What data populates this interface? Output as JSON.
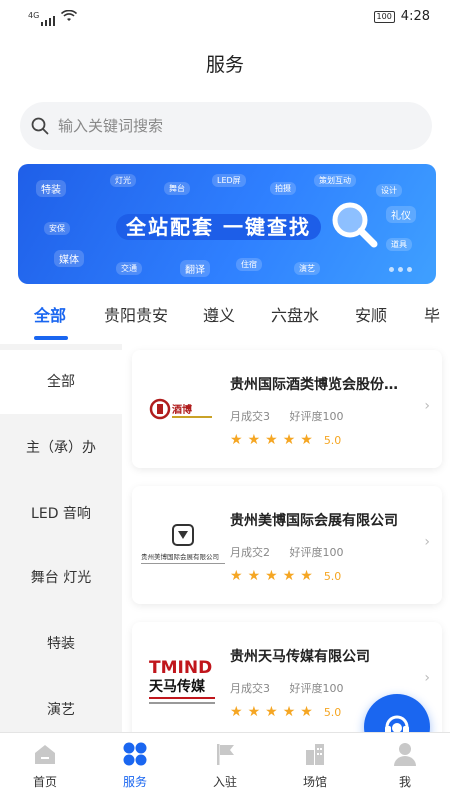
{
  "status": {
    "network": "4G",
    "battery": "100",
    "time": "4:28"
  },
  "header": {
    "title": "服务"
  },
  "search": {
    "placeholder": "输入关键词搜索"
  },
  "banner": {
    "headline": "全站配套 一键查找",
    "tags": [
      "特装",
      "灯光",
      "舞台",
      "LED屏",
      "拍摄",
      "策划互动",
      "设计",
      "礼仪",
      "安保",
      "媒体",
      "交通",
      "翻译",
      "住宿",
      "演艺",
      "道具"
    ]
  },
  "tabs": [
    "全部",
    "贵阳贵安",
    "遵义",
    "六盘水",
    "安顺",
    "毕"
  ],
  "sidebar": {
    "items": [
      "全部",
      "主（承）办",
      "LED 音响",
      "舞台 灯光",
      "特装",
      "演艺"
    ]
  },
  "cards": [
    {
      "title": "贵州国际酒类博览会股份…",
      "monthly": "月成交3",
      "praise": "好评度100",
      "rating": "5.0",
      "logo_text": "酒博"
    },
    {
      "title": "贵州美博国际会展有限公司",
      "monthly": "月成交2",
      "praise": "好评度100",
      "rating": "5.0",
      "logo_text": "贵州美博国际会展有限公司"
    },
    {
      "title": "贵州天马传媒有限公司",
      "monthly": "月成交3",
      "praise": "好评度100",
      "rating": "5.0",
      "logo_text": "天马传媒"
    }
  ],
  "tabbar": [
    {
      "label": "首页",
      "icon": "home-icon"
    },
    {
      "label": "服务",
      "icon": "services-icon"
    },
    {
      "label": "入驻",
      "icon": "flag-icon"
    },
    {
      "label": "场馆",
      "icon": "venue-icon"
    },
    {
      "label": "我",
      "icon": "user-icon"
    }
  ],
  "colors": {
    "accent": "#1a66f0",
    "star": "#f5a623"
  }
}
